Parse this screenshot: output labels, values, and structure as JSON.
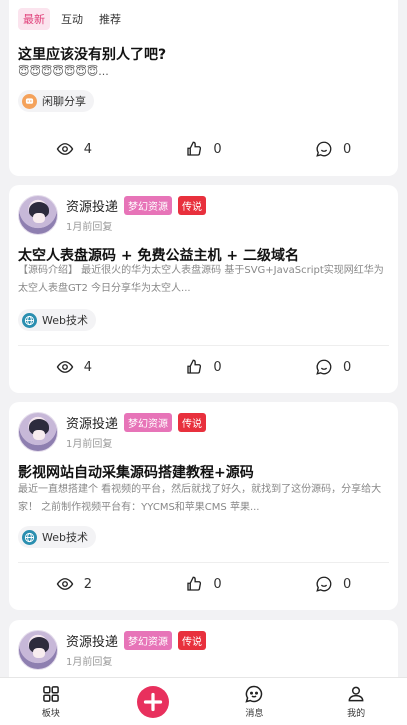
{
  "tabs": [
    {
      "label": "最新",
      "active": true
    },
    {
      "label": "互动",
      "active": false
    },
    {
      "label": "推荐",
      "active": false
    }
  ],
  "posts": [
    {
      "title": "这里应该没有别人了吧?",
      "excerpt": "😇😇😇😇😇😇😇...",
      "tag": "闲聊分享",
      "tag_icon": "chat-icon",
      "views": "4",
      "likes": "0",
      "comments": "0"
    },
    {
      "author": "资源投递",
      "badge1": "梦幻资源",
      "badge2": "传说",
      "time": "1月前回复",
      "title": "太空人表盘源码 + 免费公益主机 + 二级域名",
      "excerpt": "【源码介绍】 最近很火的华为太空人表盘源码 基于SVG+JavaScript实现网红华为太空人表盘GT2 今日分享华为太空人...",
      "tag": "Web技术",
      "tag_icon": "globe-icon",
      "views": "4",
      "likes": "0",
      "comments": "0"
    },
    {
      "author": "资源投递",
      "badge1": "梦幻资源",
      "badge2": "传说",
      "time": "1月前回复",
      "title": "影视网站自动采集源码搭建教程+源码",
      "excerpt": "最近一直想搭建个 看视频的平台，然后就找了好久，就找到了这份源码，分享给大家！ 之前制作视频平台有：YYCMS和苹果CMS 苹果...",
      "tag": "Web技术",
      "tag_icon": "globe-icon",
      "views": "2",
      "likes": "0",
      "comments": "0"
    },
    {
      "author": "资源投递",
      "badge1": "梦幻资源",
      "badge2": "传说",
      "time": "1月前回复"
    }
  ],
  "nav": {
    "blocks": "板块",
    "messages": "消息",
    "mine": "我的"
  },
  "colors": {
    "accent": "#e8305d",
    "badge_pink": "#e774b8",
    "badge_red": "#e8303d"
  }
}
